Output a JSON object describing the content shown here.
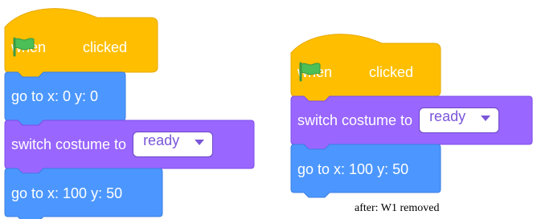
{
  "left_script": {
    "hat": {
      "label_before": "when",
      "flag_icon": "green-flag-icon",
      "label_after": "clicked"
    },
    "blocks": [
      {
        "label": "go to x: 0 y: 0"
      },
      {
        "label": "switch costume to",
        "dropdown_value": "ready"
      },
      {
        "label": "go to x: 100 y: 50"
      }
    ]
  },
  "right_script": {
    "hat": {
      "label_before": "when",
      "flag_icon": "green-flag-icon",
      "label_after": "clicked"
    },
    "blocks": [
      {
        "label": "switch costume to",
        "dropdown_value": "ready"
      },
      {
        "label": "go to x: 100 y: 50"
      }
    ]
  },
  "caption": "after: W1 removed",
  "colors": {
    "events": "#ffbf00",
    "motion": "#4c97ff",
    "looks": "#9966ff",
    "flag": "#4cbf56"
  }
}
